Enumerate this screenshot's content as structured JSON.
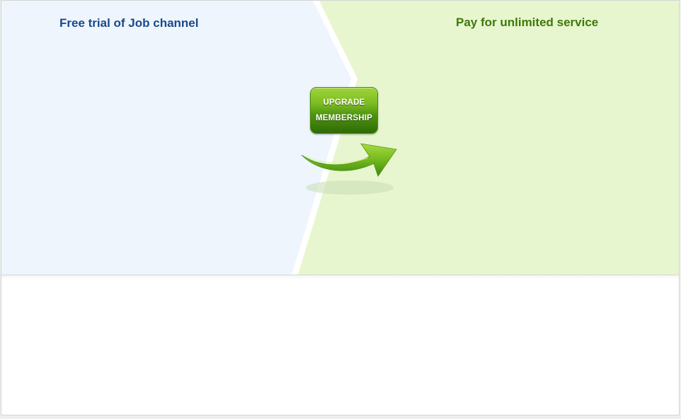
{
  "panels": {
    "free": {
      "title": "Free trial of Job channel",
      "color": "#1a4a8a",
      "background": "#eef5fd"
    },
    "paid": {
      "title": "Pay for unlimited service",
      "color": "#3d7a0a",
      "background": "#e7f6cf"
    }
  },
  "upgrade_button": {
    "line1": "UPGRADE",
    "line2": "MEMBERSHIP",
    "accent": "#5fa818"
  },
  "icons": {
    "arrow": "right-arrow-icon"
  }
}
